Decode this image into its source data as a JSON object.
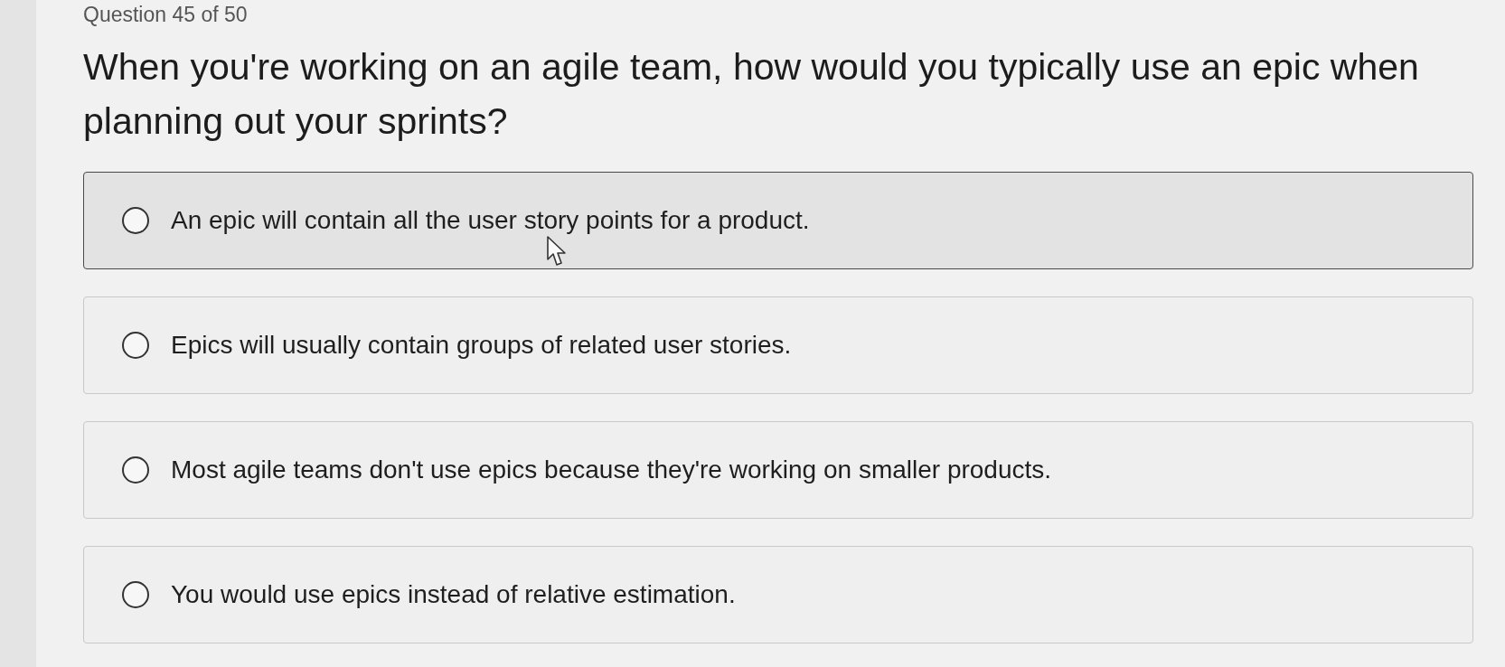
{
  "question_counter": "Question 45 of 50",
  "question": "When you're working on an agile team, how would you typically use an epic when planning out your sprints?",
  "options": [
    {
      "text": "An epic will contain all the user story points for a product.",
      "selected": false,
      "hovered": true
    },
    {
      "text": "Epics will usually contain groups of related user stories.",
      "selected": false,
      "hovered": false
    },
    {
      "text": "Most agile teams don't use epics because they're working on smaller products.",
      "selected": false,
      "hovered": false
    },
    {
      "text": "You would use epics instead of relative estimation.",
      "selected": false,
      "hovered": false
    }
  ]
}
